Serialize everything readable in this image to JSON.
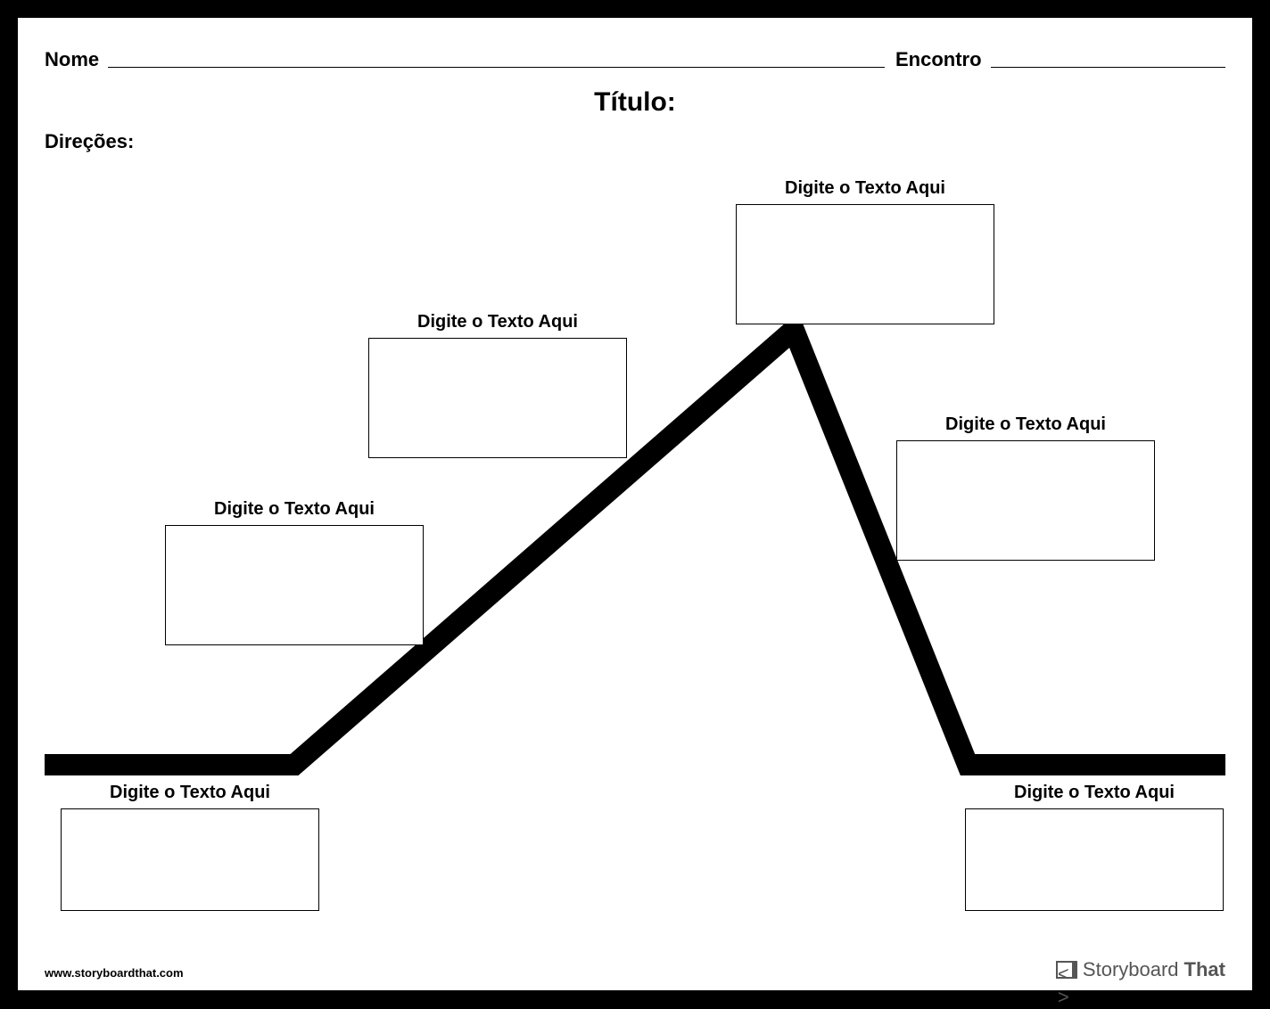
{
  "header": {
    "name_label": "Nome",
    "date_label": "Encontro"
  },
  "title_label": "Título:",
  "directions_label": "Direções:",
  "nodes": {
    "exposition": {
      "label": "Digite o Texto Aqui"
    },
    "rising1": {
      "label": "Digite o Texto Aqui"
    },
    "rising2": {
      "label": "Digite o Texto Aqui"
    },
    "climax": {
      "label": "Digite o Texto Aqui"
    },
    "falling": {
      "label": "Digite o Texto Aqui"
    },
    "resolution": {
      "label": "Digite o Texto Aqui"
    }
  },
  "footer": {
    "url": "www.storyboardthat.com",
    "brand_a": "Storyboard",
    "brand_b": "That"
  }
}
